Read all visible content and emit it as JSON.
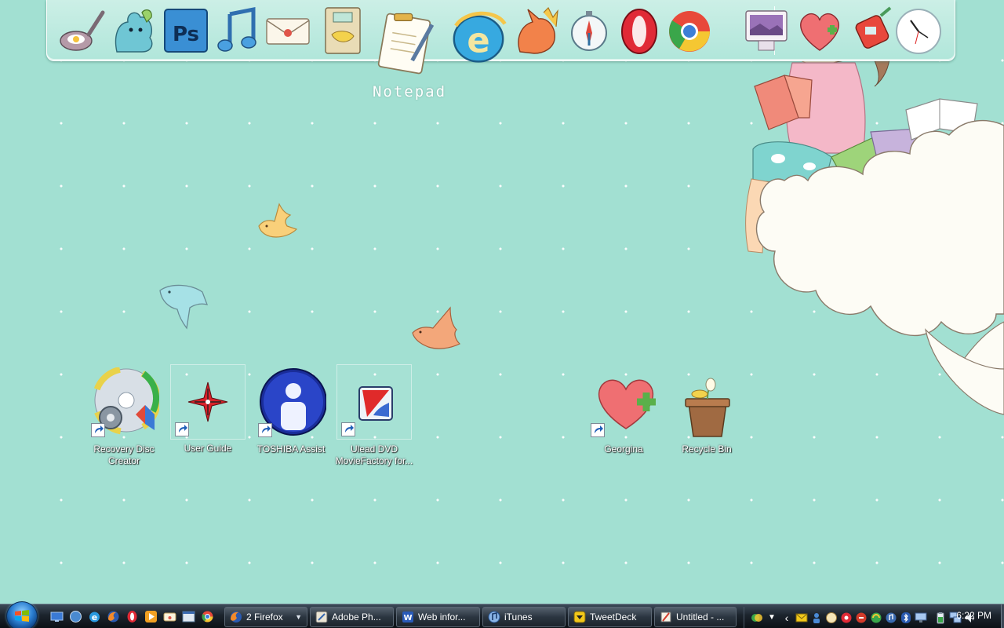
{
  "dock": {
    "hover_label": "Notepad",
    "items": [
      {
        "name": "frying-pan-icon"
      },
      {
        "name": "buddy-icon"
      },
      {
        "name": "photoshop-icon",
        "text": "Ps"
      },
      {
        "name": "music-icon"
      },
      {
        "name": "mail-icon"
      },
      {
        "name": "notebook-icon"
      },
      {
        "name": "notepad-icon"
      },
      {
        "name": "internet-explorer-icon",
        "text": "e"
      },
      {
        "name": "firefox-icon"
      },
      {
        "name": "safari-icon"
      },
      {
        "name": "opera-icon"
      },
      {
        "name": "chrome-icon"
      },
      {
        "name": "computer-icon"
      },
      {
        "name": "heart-plus-icon"
      },
      {
        "name": "pencil-sharpener-icon"
      },
      {
        "name": "clock-icon"
      }
    ]
  },
  "desktop": {
    "icons": [
      {
        "label": "Recovery Disc Creator"
      },
      {
        "label": "User Guide"
      },
      {
        "label": "TOSHIBA Assist"
      },
      {
        "label": "Ulead DVD MovieFactory for..."
      },
      {
        "label": "Georgina"
      },
      {
        "label": "Recycle Bin"
      }
    ]
  },
  "taskbar": {
    "quick_launch": [
      "show-desktop-icon",
      "switch-windows-icon",
      "internet-explorer-icon",
      "firefox-icon",
      "opera-icon",
      "media-player-icon",
      "mail-icon",
      "window-icon",
      "chrome-icon"
    ],
    "buttons": [
      {
        "label": "2 Firefox",
        "icon": "firefox-icon"
      },
      {
        "label": "Adobe Ph...",
        "icon": "photoshop-icon"
      },
      {
        "label": "Web infor...",
        "icon": "word-icon"
      },
      {
        "label": "iTunes",
        "icon": "itunes-icon"
      },
      {
        "label": "TweetDeck",
        "icon": "tweetdeck-icon"
      },
      {
        "label": "Untitled - ...",
        "icon": "paint-icon"
      }
    ],
    "tray_expand": "‹",
    "clock": "6:22 PM"
  },
  "colors": {
    "background": "#a2e0d2",
    "taskbar": "#1c242d"
  }
}
